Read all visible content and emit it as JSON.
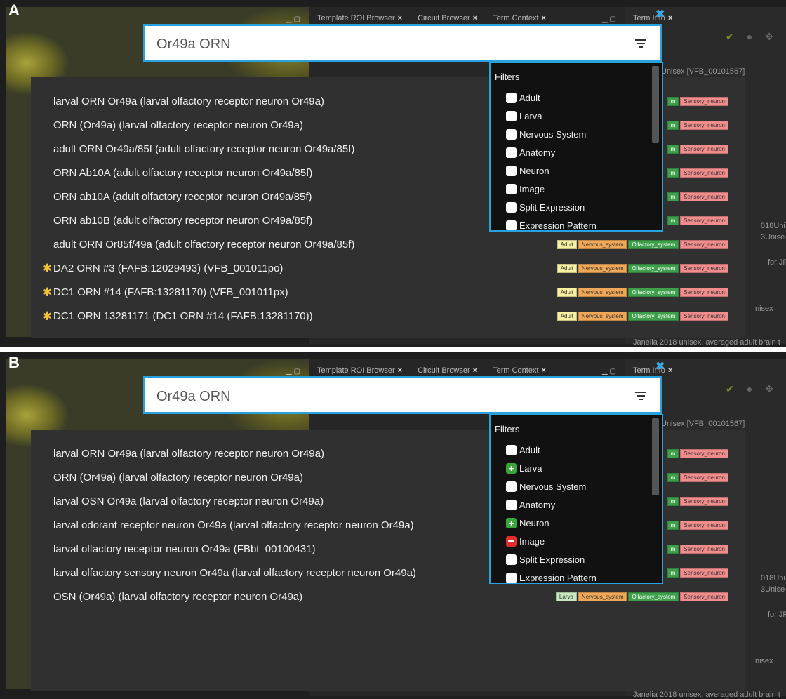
{
  "panels": {
    "A": {
      "letter": "A",
      "tabs": [
        "Template ROI Browser",
        "Circuit Browser",
        "Term Context",
        "Term Info"
      ],
      "search_value": "Or49a ORN",
      "term_info_snippet": "Unisex [VFB_00101567]",
      "right_snippets": [
        "018Uni",
        "3Unise",
        "for JF",
        "nisex",
        "Janelia 2018 unisex, averaged adult brain t"
      ],
      "filters": {
        "title": "Filters",
        "items": [
          {
            "label": "Adult",
            "state": "empty"
          },
          {
            "label": "Larva",
            "state": "empty"
          },
          {
            "label": "Nervous System",
            "state": "empty"
          },
          {
            "label": "Anatomy",
            "state": "empty"
          },
          {
            "label": "Neuron",
            "state": "empty"
          },
          {
            "label": "Image",
            "state": "empty"
          },
          {
            "label": "Split Expression",
            "state": "empty"
          },
          {
            "label": "Expression Pattern",
            "state": "empty"
          }
        ]
      },
      "results": [
        {
          "label": "larval ORN Or49a (larval olfactory receptor neuron Or49a)",
          "star": false,
          "tags": [
            "m",
            "Sensory_neuron"
          ]
        },
        {
          "label": "ORN (Or49a) (larval olfactory receptor neuron Or49a)",
          "star": false,
          "tags": [
            "m",
            "Sensory_neuron"
          ]
        },
        {
          "label": "adult ORN Or49a/85f (adult olfactory receptor neuron Or49a/85f)",
          "star": false,
          "tags": [
            "m",
            "Sensory_neuron"
          ]
        },
        {
          "label": "ORN Ab10A (adult olfactory receptor neuron Or49a/85f)",
          "star": false,
          "tags": [
            "m",
            "Sensory_neuron"
          ]
        },
        {
          "label": "ORN ab10A (adult olfactory receptor neuron Or49a/85f)",
          "star": false,
          "tags": [
            "m",
            "Sensory_neuron"
          ]
        },
        {
          "label": "ORN ab10B (adult olfactory receptor neuron Or49a/85f)",
          "star": false,
          "tags": [
            "m",
            "Sensory_neuron"
          ]
        },
        {
          "label": "adult ORN Or85f/49a (adult olfactory receptor neuron Or49a/85f)",
          "star": false,
          "tags": [
            "Adult",
            "Nervous_system",
            "Olfactory_system",
            "Sensory_neuron"
          ]
        },
        {
          "label": "DA2 ORN #3 (FAFB:12029493) (VFB_001011po)",
          "star": true,
          "tags": [
            "Adult",
            "Nervous_system",
            "Olfactory_system",
            "Sensory_neuron"
          ]
        },
        {
          "label": "DC1 ORN #14 (FAFB:13281170) (VFB_001011px)",
          "star": true,
          "tags": [
            "Adult",
            "Nervous_system",
            "Olfactory_system",
            "Sensory_neuron"
          ]
        },
        {
          "label": "DC1 ORN 13281171 (DC1 ORN #14 (FAFB:13281170))",
          "star": true,
          "tags": [
            "Adult",
            "Nervous_system",
            "Olfactory_system",
            "Sensory_neuron"
          ]
        }
      ]
    },
    "B": {
      "letter": "B",
      "tabs": [
        "Template ROI Browser",
        "Circuit Browser",
        "Term Context",
        "Term Info"
      ],
      "search_value": "Or49a ORN",
      "term_info_snippet": "Unisex [VFB_00101567]",
      "right_snippets": [
        "018Uni",
        "3Unise",
        "for JF",
        "nisex",
        "Janelia 2018 unisex, averaged adult brain t"
      ],
      "filters": {
        "title": "Filters",
        "items": [
          {
            "label": "Adult",
            "state": "empty"
          },
          {
            "label": "Larva",
            "state": "plus"
          },
          {
            "label": "Nervous System",
            "state": "empty"
          },
          {
            "label": "Anatomy",
            "state": "empty"
          },
          {
            "label": "Neuron",
            "state": "plus"
          },
          {
            "label": "Image",
            "state": "minus"
          },
          {
            "label": "Split Expression",
            "state": "empty"
          },
          {
            "label": "Expression Pattern",
            "state": "empty"
          }
        ]
      },
      "results": [
        {
          "label": "larval ORN Or49a (larval olfactory receptor neuron Or49a)",
          "star": false,
          "tags": [
            "m",
            "Sensory_neuron"
          ]
        },
        {
          "label": "ORN (Or49a) (larval olfactory receptor neuron Or49a)",
          "star": false,
          "tags": [
            "m",
            "Sensory_neuron"
          ]
        },
        {
          "label": "larval OSN Or49a (larval olfactory receptor neuron Or49a)",
          "star": false,
          "tags": [
            "m",
            "Sensory_neuron"
          ]
        },
        {
          "label": "larval odorant receptor neuron Or49a (larval olfactory receptor neuron Or49a)",
          "star": false,
          "tags": [
            "m",
            "Sensory_neuron"
          ]
        },
        {
          "label": "larval olfactory receptor neuron Or49a (FBbt_00100431)",
          "star": false,
          "tags": [
            "m",
            "Sensory_neuron"
          ]
        },
        {
          "label": "larval olfactory sensory neuron Or49a (larval olfactory receptor neuron Or49a)",
          "star": false,
          "tags": [
            "m",
            "Sensory_neuron"
          ]
        },
        {
          "label": "OSN (Or49a) (larval olfactory receptor neuron Or49a)",
          "star": false,
          "tags": [
            "Larva",
            "Nervous_system",
            "Olfactory_system",
            "Sensory_neuron"
          ]
        }
      ]
    }
  },
  "colors": {
    "accent": "#29a3e0",
    "star": "#f2c230"
  }
}
